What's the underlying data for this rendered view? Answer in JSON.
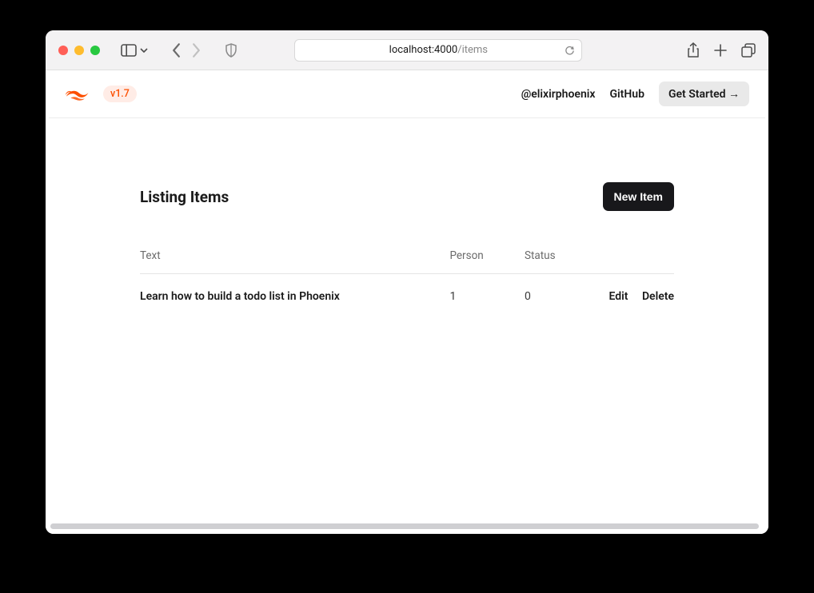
{
  "browser": {
    "url_host": "localhost:4000",
    "url_path": "/items"
  },
  "header": {
    "version": "v1.7",
    "nav": {
      "twitter": "@elixirphoenix",
      "github": "GitHub",
      "get_started": "Get Started →"
    }
  },
  "page": {
    "title": "Listing Items",
    "new_button": "New Item",
    "columns": {
      "text": "Text",
      "person": "Person",
      "status": "Status"
    },
    "rows": [
      {
        "text": "Learn how to build a todo list in Phoenix",
        "person": "1",
        "status": "0"
      }
    ],
    "actions": {
      "edit": "Edit",
      "delete": "Delete"
    }
  }
}
